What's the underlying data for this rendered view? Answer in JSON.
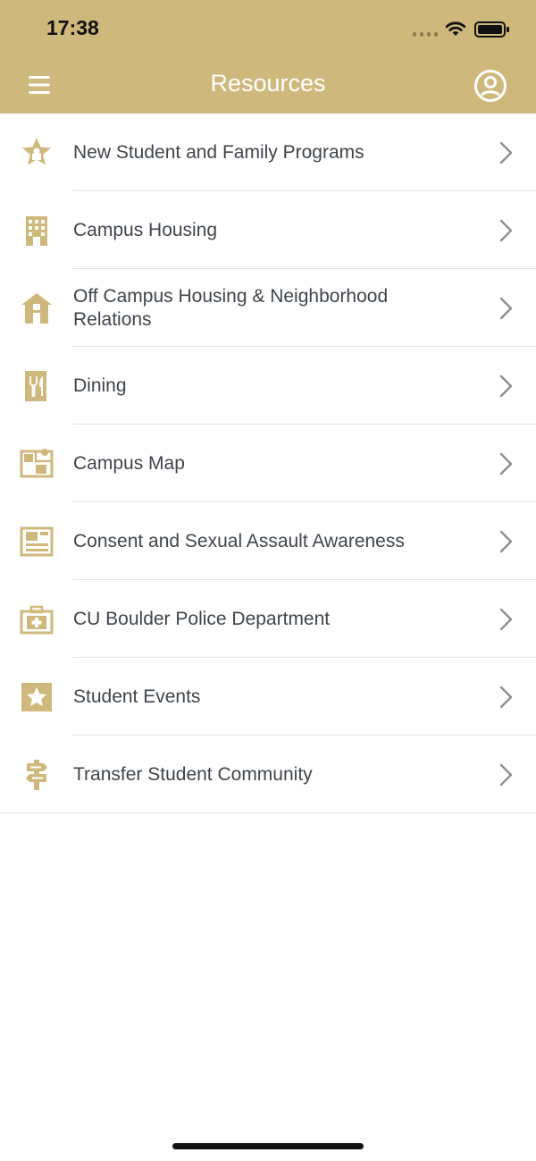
{
  "status_bar": {
    "time": "17:38"
  },
  "header": {
    "title": "Resources",
    "background_color": "#cfb87c"
  },
  "accent_color": "#cfb87c",
  "resources": [
    {
      "label": "New Student and Family Programs",
      "icon": "star-award-icon"
    },
    {
      "label": "Campus Housing",
      "icon": "building-icon"
    },
    {
      "label": "Off Campus Housing & Neighborhood Relations",
      "icon": "house-icon"
    },
    {
      "label": "Dining",
      "icon": "fork-knife-icon"
    },
    {
      "label": "Campus Map",
      "icon": "map-icon"
    },
    {
      "label": "Consent and Sexual Assault Awareness",
      "icon": "bulletin-board-icon"
    },
    {
      "label": "CU Boulder Police Department",
      "icon": "first-aid-kit-icon"
    },
    {
      "label": "Student Events",
      "icon": "star-box-icon"
    },
    {
      "label": "Transfer Student Community",
      "icon": "signpost-icon"
    }
  ]
}
